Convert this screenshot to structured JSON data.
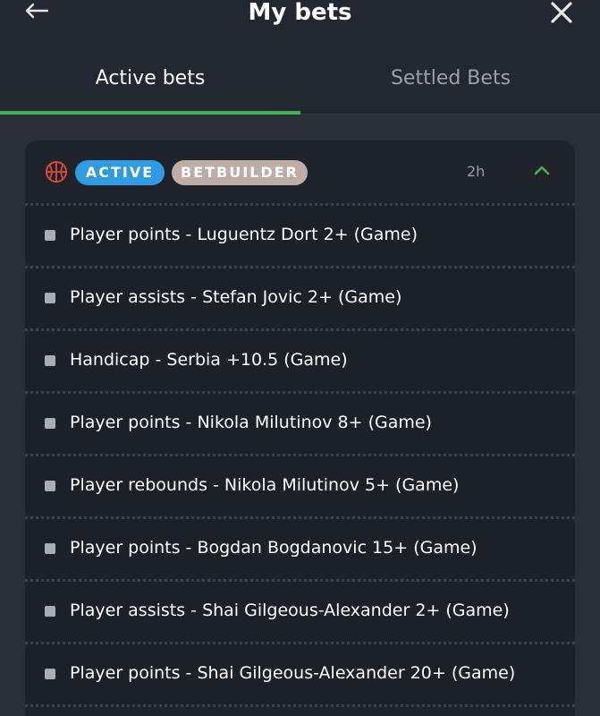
{
  "header": {
    "title": "My bets",
    "back_icon": "arrow-left-icon",
    "close_icon": "close-icon"
  },
  "tabs": [
    {
      "label": "Active bets",
      "selected": true
    },
    {
      "label": "Settled Bets",
      "selected": false
    }
  ],
  "colors": {
    "accent": "#3fb34f",
    "active_badge": "#2f9be3",
    "betbuilder_badge": "#bcaea6",
    "sport_icon": "#d9483b"
  },
  "bet": {
    "sport_icon": "basketball-icon",
    "status_badge": "ACTIVE",
    "type_badge": "BETBUILDER",
    "time": "2h",
    "expanded": true,
    "legs": [
      "Player points - Luguentz Dort 2+ (Game)",
      "Player assists - Stefan Jovic 2+ (Game)",
      "Handicap - Serbia +10.5 (Game)",
      "Player points - Nikola Milutinov 8+ (Game)",
      "Player rebounds - Nikola Milutinov 5+ (Game)",
      "Player points - Bogdan Bogdanovic 15+ (Game)",
      "Player assists - Shai Gilgeous-Alexander 2+ (Game)",
      "Player points - Shai Gilgeous-Alexander 20+ (Game)"
    ]
  }
}
